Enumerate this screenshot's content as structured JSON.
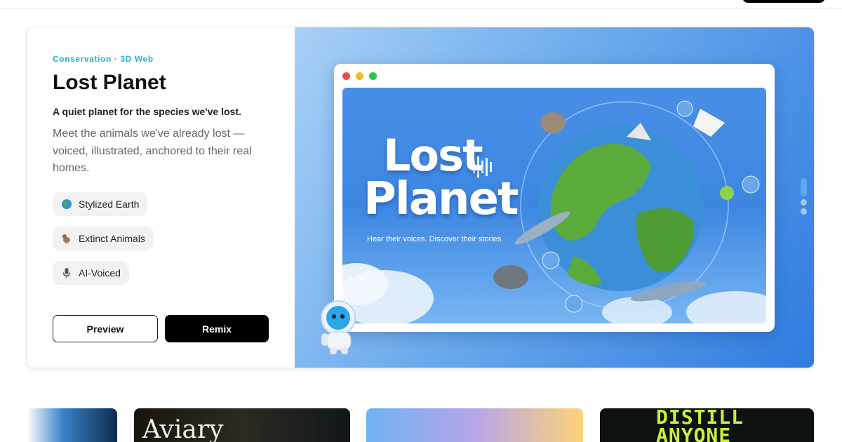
{
  "featured": {
    "eyebrow": "Conservation · 3D Web",
    "title": "Lost Planet",
    "tagline": "A quiet planet for the species we've lost.",
    "description": "Meet the animals we've already lost — voiced, illustrated, anchored to their real homes.",
    "features": [
      {
        "icon": "globe-icon",
        "label": "Stylized Earth"
      },
      {
        "icon": "dodo-icon",
        "label": "Extinct Animals"
      },
      {
        "icon": "microphone-icon",
        "label": "AI-Voiced"
      }
    ],
    "actions": {
      "preview_label": "Preview",
      "remix_label": "Remix"
    },
    "preview": {
      "title_line1": "Lost",
      "title_line2": "Planet",
      "subtitle": "Hear their voices. Discover their stories."
    }
  },
  "carousel": {
    "slides": 3,
    "active_index": 0
  },
  "gallery": [
    {
      "name": "Aviary"
    },
    {
      "name": "DISTILL ANYONE"
    }
  ],
  "colors": {
    "accent": "#25b0d0",
    "hero_gradient_start": "#a8d0f6",
    "hero_gradient_end": "#2f7be0",
    "primary_button": "#000000"
  }
}
